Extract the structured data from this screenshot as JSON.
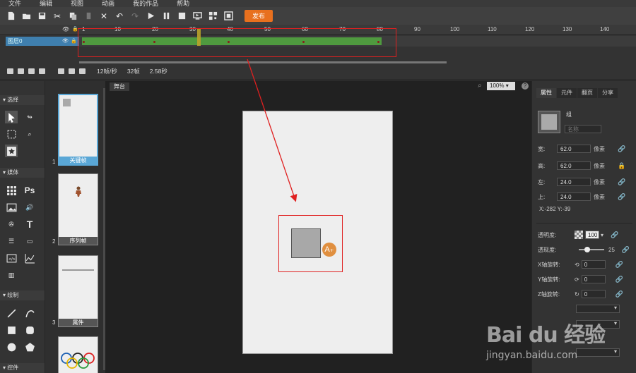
{
  "menu": [
    "文件",
    "编辑",
    "视图",
    "动画",
    "我的作品",
    "帮助"
  ],
  "toolbar": {
    "publish_label": "发布"
  },
  "timeline": {
    "ruler_ticks": [
      "1",
      "10",
      "20",
      "30",
      "40",
      "50",
      "60",
      "70",
      "80",
      "90",
      "100",
      "110",
      "120",
      "130",
      "140"
    ],
    "layer_name": "图层0"
  },
  "statusbar": {
    "fps": "12帧/秒",
    "frames": "32帧",
    "duration": "2.58秒"
  },
  "tools": {
    "sections": [
      "选择",
      "媒体",
      "绘制",
      "控件"
    ]
  },
  "pages": [
    {
      "num": "1",
      "label": "关键帧"
    },
    {
      "num": "2",
      "label": "序列帧"
    },
    {
      "num": "3",
      "label": "属件"
    }
  ],
  "stage": {
    "tab": "舞台",
    "zoom": "100%"
  },
  "props": {
    "tabs": [
      "属性",
      "元件",
      "翻页",
      "分享"
    ],
    "group_label": "组",
    "name_placeholder": "名称",
    "width_label": "宽:",
    "width_value": "62.0",
    "height_label": "高:",
    "height_value": "62.0",
    "left_label": "左:",
    "left_value": "24.0",
    "top_label": "上:",
    "top_value": "24.0",
    "unit": "像素",
    "coords": "X:-282   Y:-39",
    "opacity_label": "透明度:",
    "opacity_value": "100",
    "blur_label": "透现度:",
    "blur_value": "25",
    "xrot_label": "X轴旋转:",
    "xrot_value": "0",
    "yrot_label": "Y轴旋转:",
    "yrot_value": "0",
    "zrot_label": "Z轴旋转:",
    "zrot_value": "0"
  },
  "watermark": {
    "brand": "Bai du 经验",
    "url": "jingyan.baidu.com"
  },
  "colors": {
    "accent_orange": "#e8701e",
    "timeline_green": "#4f9a3f",
    "selection_blue": "#5aa7d6",
    "annotation_red": "#e02020"
  }
}
